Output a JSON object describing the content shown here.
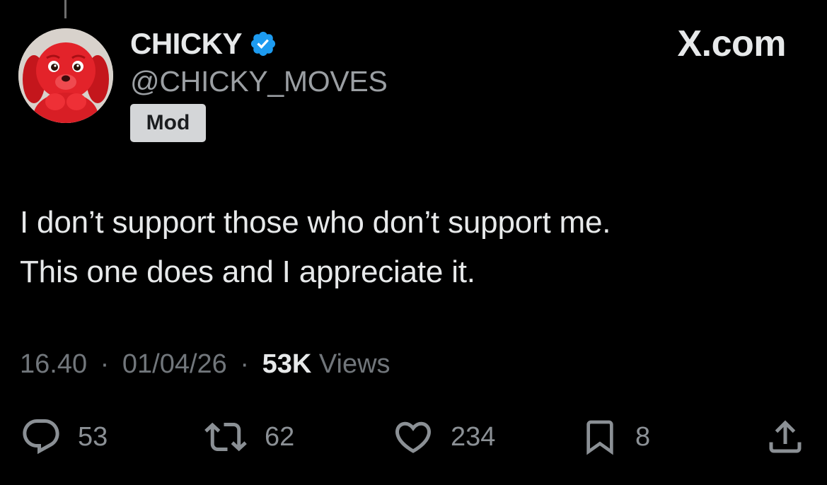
{
  "author": {
    "display_name": "CHICKY",
    "handle": "@CHICKY_MOVES",
    "badge": "Mod",
    "verified": true,
    "verified_color": "#1d9bf0",
    "avatar_icon": "red-puppy-avatar"
  },
  "site": {
    "logo_text": "X.com"
  },
  "post": {
    "line1": "I don’t support those who don’t support me.",
    "line2": "This one does and I appreciate it."
  },
  "meta": {
    "time": "16.40",
    "date": "01/04/26",
    "separator": "·",
    "views_count": "53K",
    "views_label": "Views"
  },
  "actions": {
    "replies": {
      "icon": "reply-icon",
      "count": "53"
    },
    "reposts": {
      "icon": "repost-icon",
      "count": "62"
    },
    "likes": {
      "icon": "like-heart-icon",
      "count": "234"
    },
    "bookmarks": {
      "icon": "bookmark-icon",
      "count": "8"
    },
    "share": {
      "icon": "share-icon"
    }
  },
  "colors": {
    "background": "#000000",
    "primary_text": "#e7e9ea",
    "secondary_text": "#71767b",
    "badge_bg": "#d4d6d8"
  }
}
